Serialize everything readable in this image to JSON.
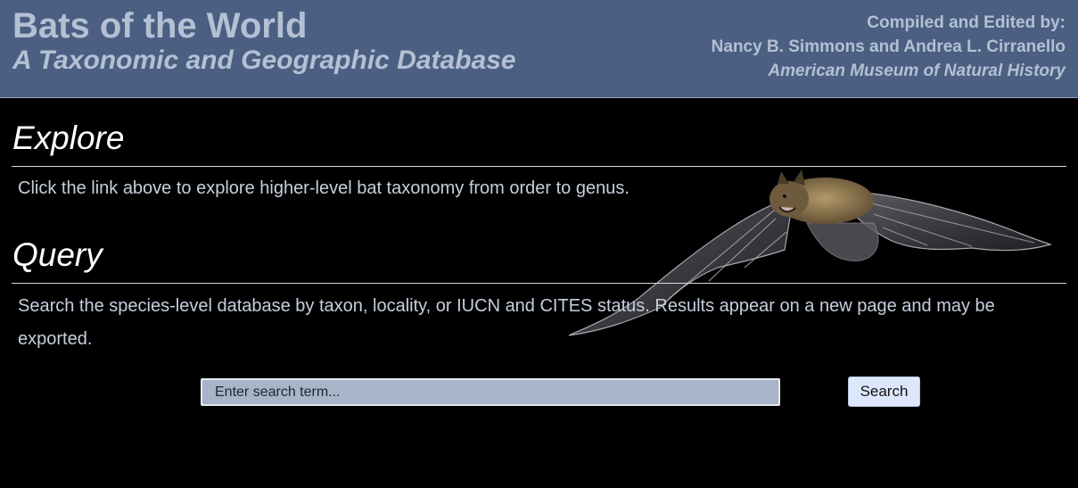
{
  "header": {
    "title": "Bats of the World",
    "subtitle": "A Taxonomic and Geographic Database",
    "credits_label": "Compiled and Edited by:",
    "editors": "Nancy B. Simmons and Andrea L. Cirranello",
    "institution": "American Museum of Natural History"
  },
  "explore": {
    "heading": "Explore",
    "text": "Click the link above to explore higher-level bat taxonomy from order to genus."
  },
  "query": {
    "heading": "Query",
    "text": "Search the species-level database by taxon, locality, or IUCN and CITES status. Results appear on a new page and may be exported."
  },
  "search": {
    "placeholder": "Enter search term...",
    "value": "",
    "button_label": "Search"
  },
  "colors": {
    "header_bg": "#4a5f82",
    "header_text": "#b4c0d3",
    "body_bg": "#000000",
    "heading_text": "#ffffff",
    "body_text": "#c6cfdd",
    "input_bg": "#a8b4c7",
    "button_bg": "#dde7fb"
  },
  "images": {
    "background": "flying-bat-photo"
  }
}
